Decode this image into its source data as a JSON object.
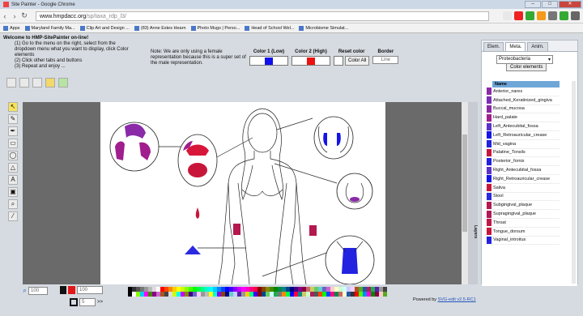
{
  "browser": {
    "tab_title": "Site Painter - Google Chrome",
    "url_host": "www.hmpdacc.org",
    "url_path": "/sp/taxa_rdp_l3/",
    "bookmarks": [
      "Apps",
      "Maryland Family Ma...",
      "Clip Art and Design ...",
      "(83) Anne Estes Hearn",
      "Photo Mugs | Perso...",
      "Head of School Wel...",
      "Microbiome Simulat..."
    ]
  },
  "header": {
    "welcome": "Welcome to HMP-SitePainter on-line!",
    "steps": [
      "(1) Go to the menu on the right, select from the dropdown menu what you want to display, click Color elements",
      "(2) Click other tabs and buttons",
      "(3) Repeat and enjoy ..."
    ],
    "note": "Note: We are only using a female representation because this is a super set of the male representation."
  },
  "color_controls": {
    "color1_label": "Color 1 (Low)",
    "color1_value": "#1010ee",
    "color2_label": "Color 2 (High)",
    "color2_value": "#ee1010",
    "reset_label": "Reset color",
    "reset_button": "Color All",
    "border_label": "Border",
    "border_value": "Line"
  },
  "bottom": {
    "zoom": "100",
    "stroke_width": "100",
    "opacity": "5",
    "credit_prefix": "Powered by ",
    "credit_link": "SVG-edit v2.5-RC1"
  },
  "layers_label": "Layers",
  "panel": {
    "tabs": [
      "Elem.",
      "Meta.",
      "Anim."
    ],
    "active_tab": "Meta.",
    "dropdown_value": "Proteobacteria",
    "color_button": "Color elements",
    "table_header": "Name",
    "rows": [
      {
        "name": "Anterior_nares",
        "color": "#8a2aa8"
      },
      {
        "name": "Attached_Keratinized_gingiva",
        "color": "#7b2fb5"
      },
      {
        "name": "Buccal_mucosa",
        "color": "#8a2aa8"
      },
      {
        "name": "Hard_palate",
        "color": "#a01e8e"
      },
      {
        "name": "Left_Antecubital_fossa",
        "color": "#5a34c8"
      },
      {
        "name": "Left_Retroauricular_crease",
        "color": "#1414e8"
      },
      {
        "name": "Mid_vagina",
        "color": "#2222e0"
      },
      {
        "name": "Palatine_Tonsils",
        "color": "#c8163a"
      },
      {
        "name": "Posterior_fornix",
        "color": "#2020e2"
      },
      {
        "name": "Right_Antecubital_fossa",
        "color": "#5a34c8"
      },
      {
        "name": "Right_Retroauricular_crease",
        "color": "#1414e8"
      },
      {
        "name": "Saliva",
        "color": "#c8163a"
      },
      {
        "name": "Stool",
        "color": "#2a2ae0"
      },
      {
        "name": "Subgingival_plaque",
        "color": "#b3184e"
      },
      {
        "name": "Supragingival_plaque",
        "color": "#b01a56"
      },
      {
        "name": "Throat",
        "color": "#c01648"
      },
      {
        "name": "Tongue_dorsum",
        "color": "#c8163a"
      },
      {
        "name": "Vaginal_introitus",
        "color": "#2222e0"
      }
    ]
  },
  "figure_colors": {
    "nares": "#8a2aa8",
    "palate": "#a01e8e",
    "tonsils": "#c8163a",
    "ear": "#1414e8",
    "vagina": "#2222e0",
    "saliva": "#c8163a",
    "stool": "#2a2ae0",
    "fossa": "#b3184e",
    "gingiva": "#d8163a"
  }
}
